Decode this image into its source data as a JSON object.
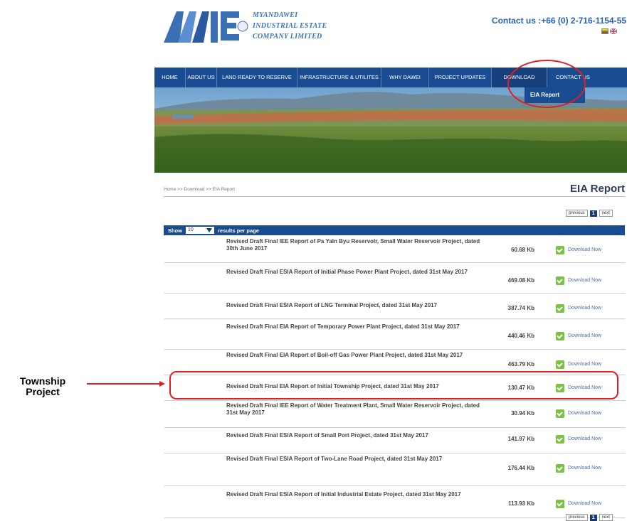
{
  "header": {
    "logo_text": "MIE",
    "company_line1": "MYANDAWEI",
    "company_line2": "INDUSTRIAL ESTATE",
    "company_line3": "COMPANY LIMITED",
    "contact": "Contact us :+66 (0) 2-716-1154-55"
  },
  "nav": {
    "items": [
      {
        "label": "HOME"
      },
      {
        "label": "ABOUT US"
      },
      {
        "label": "LAND READY TO RESERVE"
      },
      {
        "label": "INFRASTRUCTURE & UTILITES"
      },
      {
        "label": "WHY DAWEI"
      },
      {
        "label": "PROJECT UPDATES"
      },
      {
        "label": "DOWNLOAD"
      },
      {
        "label": "CONTACT US"
      }
    ],
    "submenu_item": "EIA Report"
  },
  "breadcrumb": "Home >> Download >> EIA Report",
  "page_title": "EIA Report",
  "pager": {
    "previous": "previous",
    "current": "1",
    "next": "next"
  },
  "table": {
    "show_label": "Show",
    "per_page_value": "10",
    "per_page_suffix": "results per page",
    "download_label": "Download Now",
    "rows": [
      {
        "title": "Revised Draft Final IEE Report of Pa Yaln Byu Reservolr, Small Water Reservoir Project, dated 30th June 2017",
        "size": "60.68 Kb"
      },
      {
        "title": "Revised Draft Final ESIA Report of Initial Phase Power Plant Project, dated 31st May 2017",
        "size": "469.08 Kb"
      },
      {
        "title": "Revised Draft Final ESIA Report of LNG Terminal Project, dated 31st May 2017",
        "size": "387.74 Kb"
      },
      {
        "title": "Revised Draft Final EIA Report of Temporary Power Plant Project, dated 31st May 2017",
        "size": "440.46 Kb"
      },
      {
        "title": "Revised Draft Final EIA Report of Boil-off Gas Power Plant Project, dated 31st May 2017",
        "size": "463.79 Kb"
      },
      {
        "title": "Revised Draft Final EIA Report of Initial Township Project, dated 31st May 2017",
        "size": "130.47 Kb"
      },
      {
        "title": "Revised Draft Final IEE Report of Water Treatment Plant, Small Water Reservoir Project, dated 31st May 2017",
        "size": "30.94 Kb"
      },
      {
        "title": "Revised Draft Final ESIA Report of Small Port Project, dated 31st May 2017",
        "size": "141.97 Kb"
      },
      {
        "title": "Revised Draft Final ESIA Report of Two-Lane Road Project, dated 31st May 2017",
        "size": "176.44 Kb"
      },
      {
        "title": "Revised Draft Final ESIA Report of Initial Industrial Estate Project, dated 31st May 2017",
        "size": "113.93 Kb"
      }
    ]
  },
  "annotation": {
    "line1": "Township",
    "line2": "Project"
  },
  "colors": {
    "nav": "#1a4c92",
    "accent": "#2b62b4",
    "highlight": "#e02020",
    "download_icon": "#7cc242"
  }
}
